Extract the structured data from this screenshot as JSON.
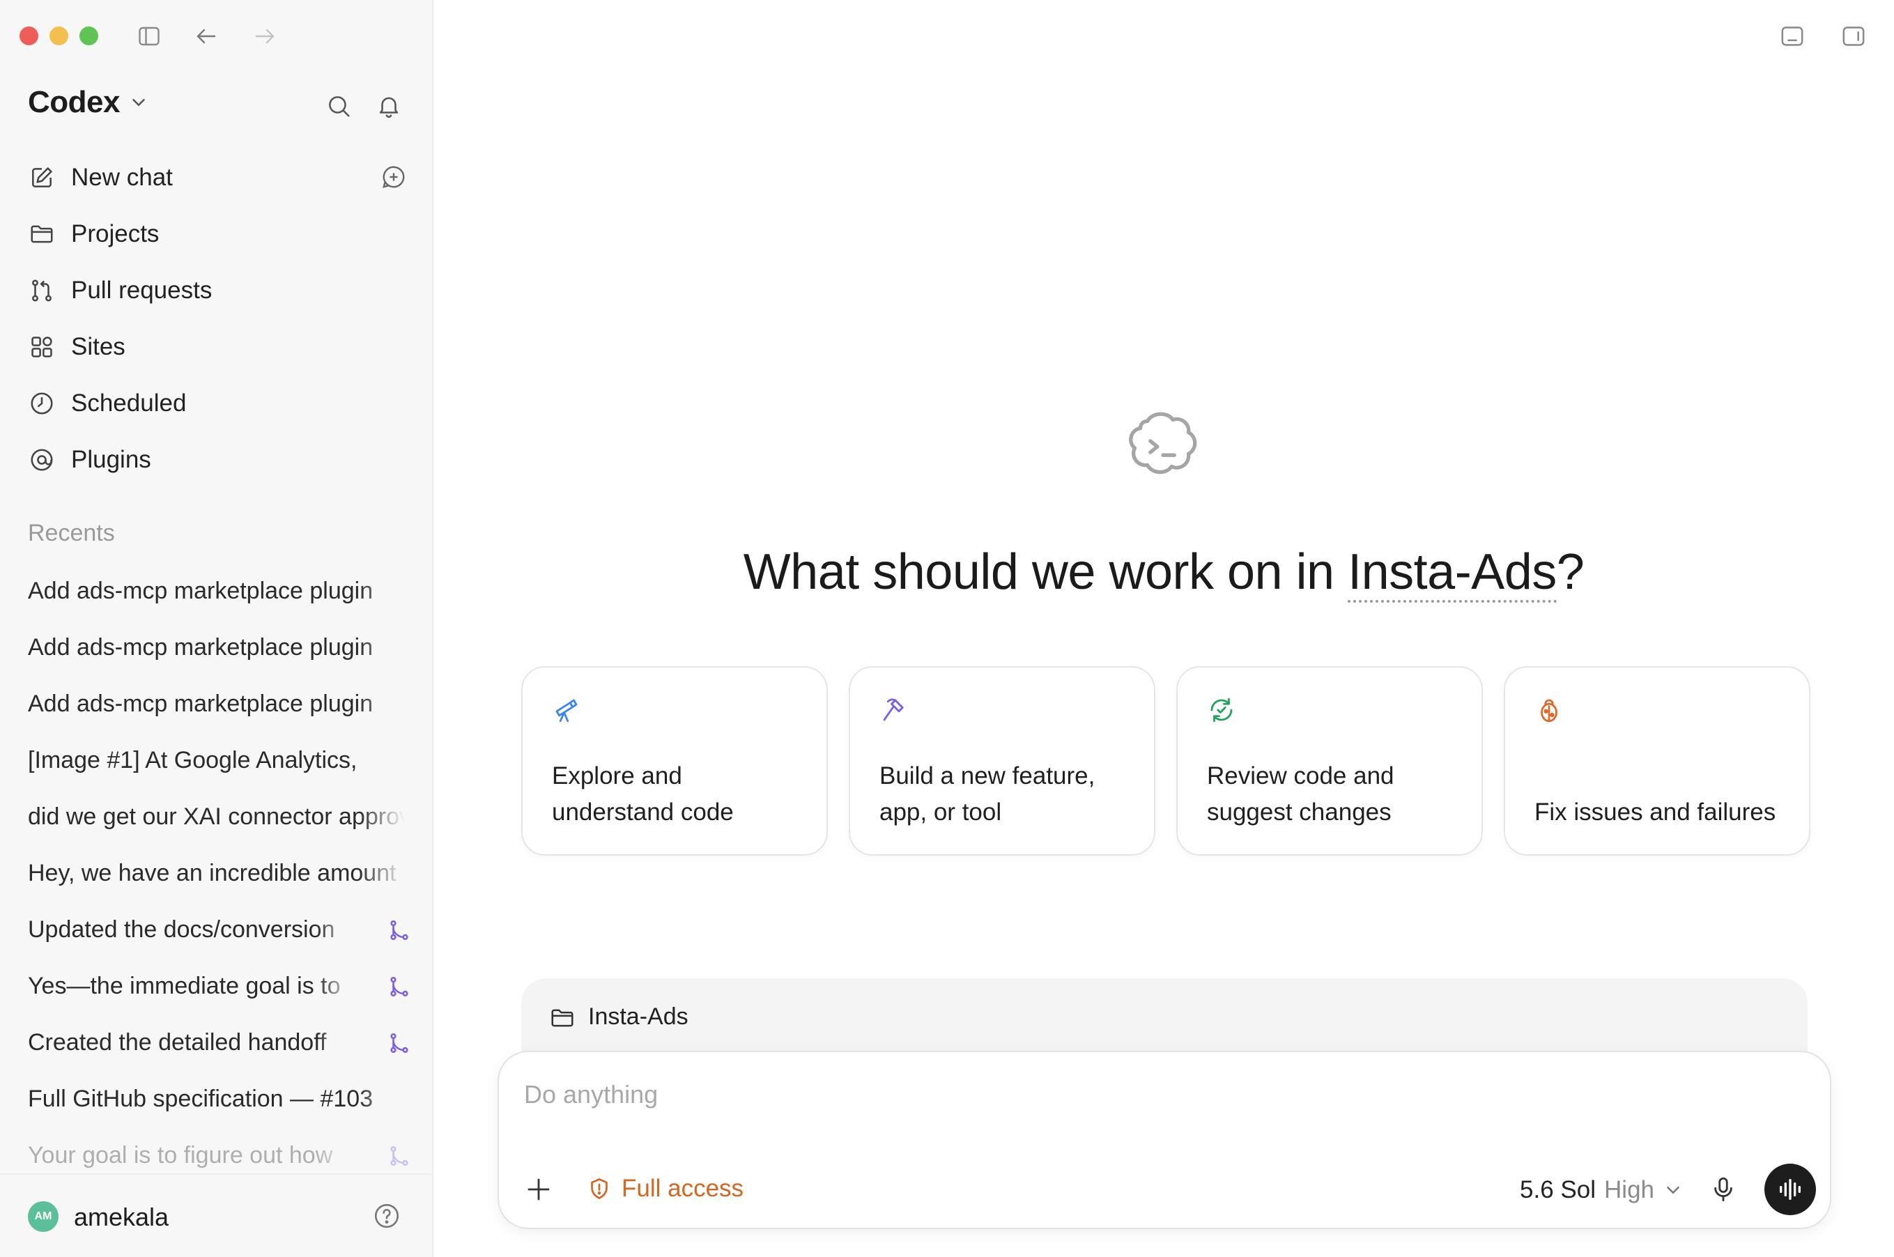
{
  "sidebar": {
    "brand": "Codex",
    "nav": [
      {
        "label": "New chat",
        "icon": "edit-icon"
      },
      {
        "label": "Projects",
        "icon": "folder-icon"
      },
      {
        "label": "Pull requests",
        "icon": "pull-request-icon"
      },
      {
        "label": "Sites",
        "icon": "grid-icon"
      },
      {
        "label": "Scheduled",
        "icon": "clock-icon"
      },
      {
        "label": "Plugins",
        "icon": "plugin-icon"
      }
    ],
    "recents_label": "Recents",
    "recents": [
      {
        "text": "Add ads-mcp marketplace plugin"
      },
      {
        "text": "Add ads-mcp marketplace plugin"
      },
      {
        "text": "Add ads-mcp marketplace plugin"
      },
      {
        "text": "[Image #1] At Google Analytics,"
      },
      {
        "text": "did we get our XAI connector approved"
      },
      {
        "text": "Hey, we have an incredible amount"
      },
      {
        "text": "Updated the docs/conversion"
      },
      {
        "text": "Yes—the immediate goal is to"
      },
      {
        "text": "Created the detailed handoff"
      },
      {
        "text": "Full GitHub specification — #103"
      },
      {
        "text": "Your goal is to figure out how"
      }
    ],
    "user": {
      "initials": "AM",
      "name": "amekala"
    }
  },
  "main": {
    "title_prefix": "What should we work on in ",
    "project_name": "Insta-Ads",
    "title_suffix": "?",
    "cards": [
      {
        "label": "Explore and understand code",
        "icon": "telescope-icon",
        "color": "#3b82f6"
      },
      {
        "label": "Build a new feature, app, or tool",
        "icon": "hammer-icon",
        "color": "#7c5cf0"
      },
      {
        "label": "Review code and suggest changes",
        "icon": "review-refresh-icon",
        "color": "#22a35a"
      },
      {
        "label": "Fix issues and failures",
        "icon": "bug-icon",
        "color": "#e0662a"
      }
    ],
    "project_tab": "Insta-Ads",
    "composer": {
      "placeholder": "Do anything",
      "access_label": "Full access",
      "model_name": "5.6 Sol",
      "model_level": "High"
    }
  },
  "colors": {
    "accent_orange": "#d4661f",
    "branch_purple": "#7c5cf0"
  }
}
